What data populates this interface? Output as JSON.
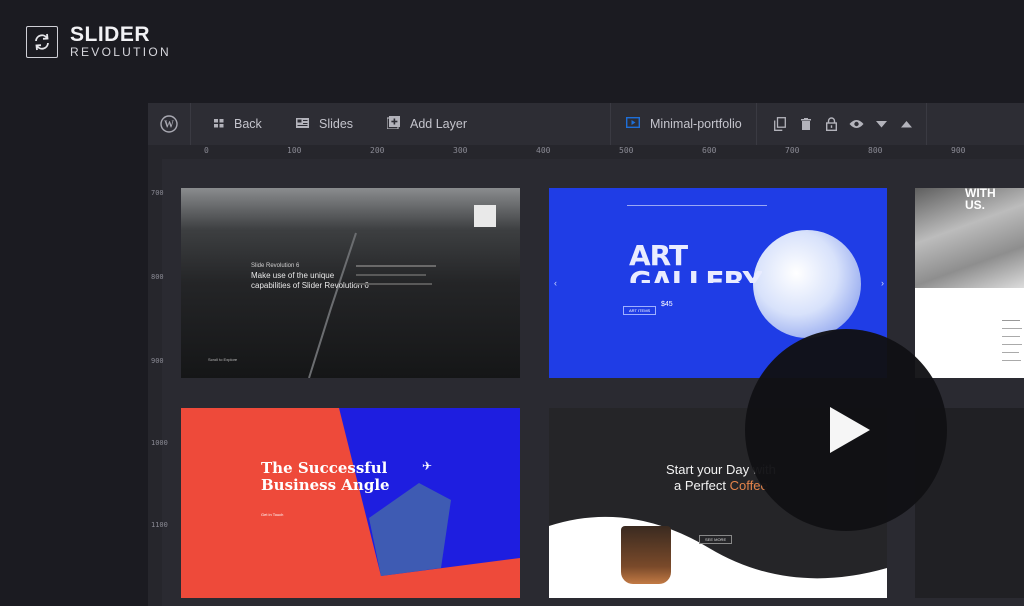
{
  "brand": {
    "name": "SLIDER",
    "sub": "REVOLUTION"
  },
  "toolbar": {
    "back_label": "Back",
    "slides_label": "Slides",
    "add_layer_label": "Add Layer",
    "slider_name": "Minimal-portfolio",
    "icons": [
      "wordpress-icon",
      "grid-icon",
      "slides-icon",
      "add-layer-icon",
      "play-box-icon",
      "copy-icon",
      "trash-icon",
      "lock-icon",
      "eye-icon",
      "arrow-down-icon",
      "arrow-up-icon"
    ]
  },
  "ruler": {
    "top": [
      "0",
      "100",
      "200",
      "300",
      "400",
      "500",
      "600",
      "700",
      "800",
      "900"
    ],
    "left": [
      "700",
      "800",
      "900",
      "1000",
      "1100"
    ]
  },
  "slides": {
    "s1": {
      "heading": "Slide Revolution 6",
      "text": "Make use of the unique capabilities of Slider Revolution 6",
      "footer": "Scroll to Explore"
    },
    "s2": {
      "title1": "ART",
      "title2": "GALLERY",
      "price": "$45",
      "button": "ART ITEMS"
    },
    "s3": {
      "title": "WITH US."
    },
    "s4": {
      "title1": "The Successful",
      "title2": "Business Angle",
      "button": "Get in Touch"
    },
    "s5": {
      "title1": "Start your Day with",
      "title2a": "a Perfect ",
      "title2b": "Coffee",
      "button": "SEE MORE"
    }
  },
  "colors": {
    "accent_blue": "#1e6fd9",
    "slide_blue": "#1f3de6",
    "slide_red": "#ee4a3a",
    "coffee": "#e5844a"
  }
}
